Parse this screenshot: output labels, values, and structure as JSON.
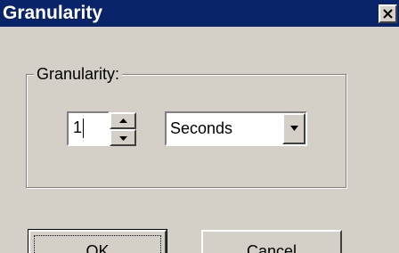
{
  "window": {
    "title": "Granularity"
  },
  "group": {
    "label": "Granularity:"
  },
  "quantity": {
    "value": "1"
  },
  "unit": {
    "selected": "Seconds"
  },
  "buttons": {
    "ok": "OK",
    "cancel": "Cancel"
  },
  "icons": {
    "close": "close-icon",
    "spin_up": "arrow-up-icon",
    "spin_down": "arrow-down-icon",
    "dropdown": "chevron-down-icon"
  },
  "colors": {
    "titlebar": "#0a246a",
    "face": "#d4d0c8"
  }
}
